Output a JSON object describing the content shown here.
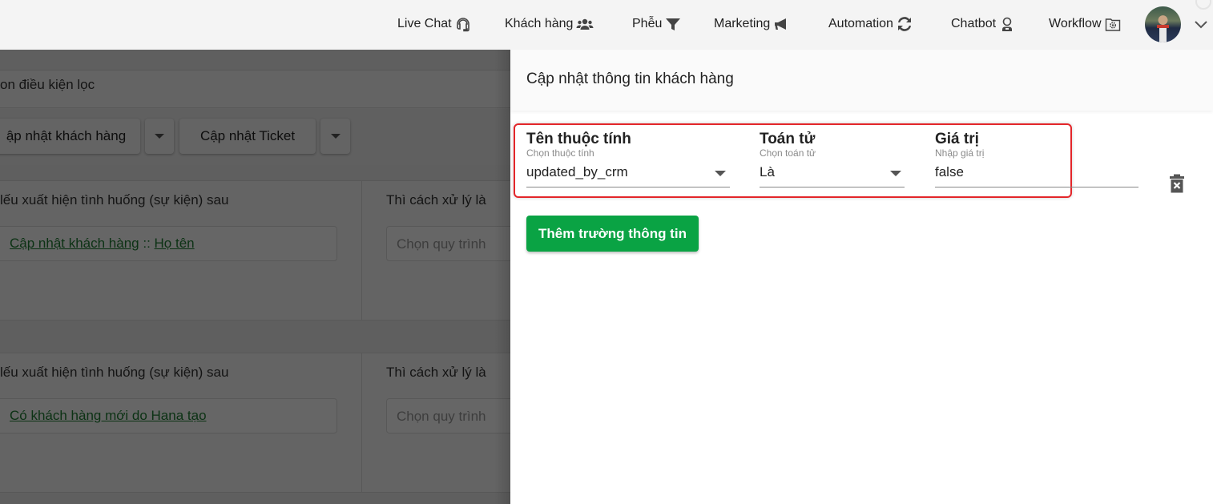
{
  "topbar": {
    "nav": [
      {
        "label": "Live Chat",
        "icon": "headset-icon"
      },
      {
        "label": "Khách hàng",
        "icon": "users-icon"
      },
      {
        "label": "Phễu",
        "icon": "filter-icon"
      },
      {
        "label": "Marketing",
        "icon": "megaphone-icon"
      },
      {
        "label": "Automation",
        "icon": "sync-icon"
      },
      {
        "label": "Chatbot",
        "icon": "robot-icon"
      },
      {
        "label": "Workflow",
        "icon": "workflow-gear-icon"
      }
    ],
    "user_menu_icon": "chevron-down-icon"
  },
  "background_page": {
    "filter_text": "on điều kiện lọc",
    "buttons": [
      {
        "label": "ập nhật khách hàng"
      },
      {
        "label": "Cập nhật Ticket"
      }
    ],
    "rules": [
      {
        "event_label": "lếu xuất hiện tình huống (sự kiện) sau",
        "handler_label": "Thì cách xử lý là",
        "event_parts": [
          "Cập nhật khách hàng",
          " :: ",
          "Họ tên"
        ],
        "process_placeholder": "Chọn quy trình"
      },
      {
        "event_label": "lếu xuất hiện tình huống (sự kiện) sau",
        "handler_label": "Thì cách xử lý là",
        "event_parts": [
          "Có khách hàng mới do Hana tạo"
        ],
        "process_placeholder": "Chọn quy trình"
      }
    ]
  },
  "drawer": {
    "title": "Cập nhật thông tin khách hàng",
    "fields": {
      "attribute": {
        "label": "Tên thuộc tính",
        "hint": "Chọn thuộc tính",
        "value": "updated_by_crm"
      },
      "operator": {
        "label": "Toán tử",
        "hint": "Chọn toán tử",
        "value": "Là"
      },
      "value": {
        "label": "Giá trị",
        "hint": "Nhập giá trị",
        "value": "false"
      }
    },
    "add_button_label": "Thêm trường thông tin",
    "highlight_color": "#e3262a",
    "accent_color": "#0aa344"
  }
}
